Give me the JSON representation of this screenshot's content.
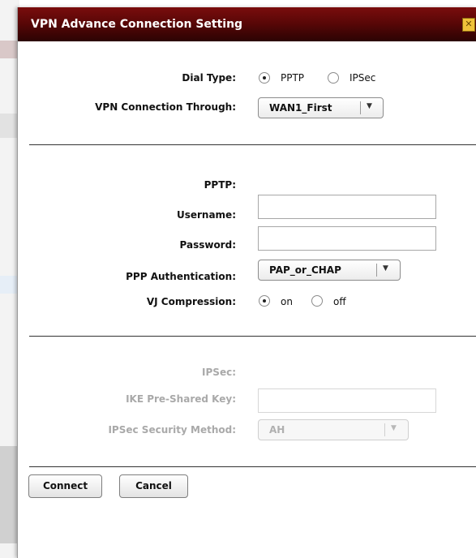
{
  "dialog": {
    "title": "VPN Advance Connection Setting",
    "close_icon": "close-icon",
    "accent_color": "#5a0707"
  },
  "connection": {
    "dial_type_label": "Dial Type:",
    "dial_options": [
      {
        "label": "PPTP",
        "selected": true
      },
      {
        "label": "IPSec",
        "selected": false
      }
    ],
    "through_label": "VPN Connection Through:",
    "through_value": "WAN1_First"
  },
  "pptp": {
    "heading": "PPTP:",
    "username_label": "Username:",
    "username_value": "",
    "password_label": "Password:",
    "password_value": "",
    "auth_label": "PPP Authentication:",
    "auth_value": "PAP_or_CHAP",
    "vj_label": "VJ Compression:",
    "vj_options": [
      {
        "label": "on",
        "selected": true
      },
      {
        "label": "off",
        "selected": false
      }
    ]
  },
  "ipsec": {
    "heading": "IPSec:",
    "key_label": "IKE Pre-Shared Key:",
    "key_value": "",
    "method_label": "IPSec Security Method:",
    "method_value": "AH",
    "disabled": true
  },
  "actions": {
    "connect_label": "Connect",
    "cancel_label": "Cancel"
  }
}
